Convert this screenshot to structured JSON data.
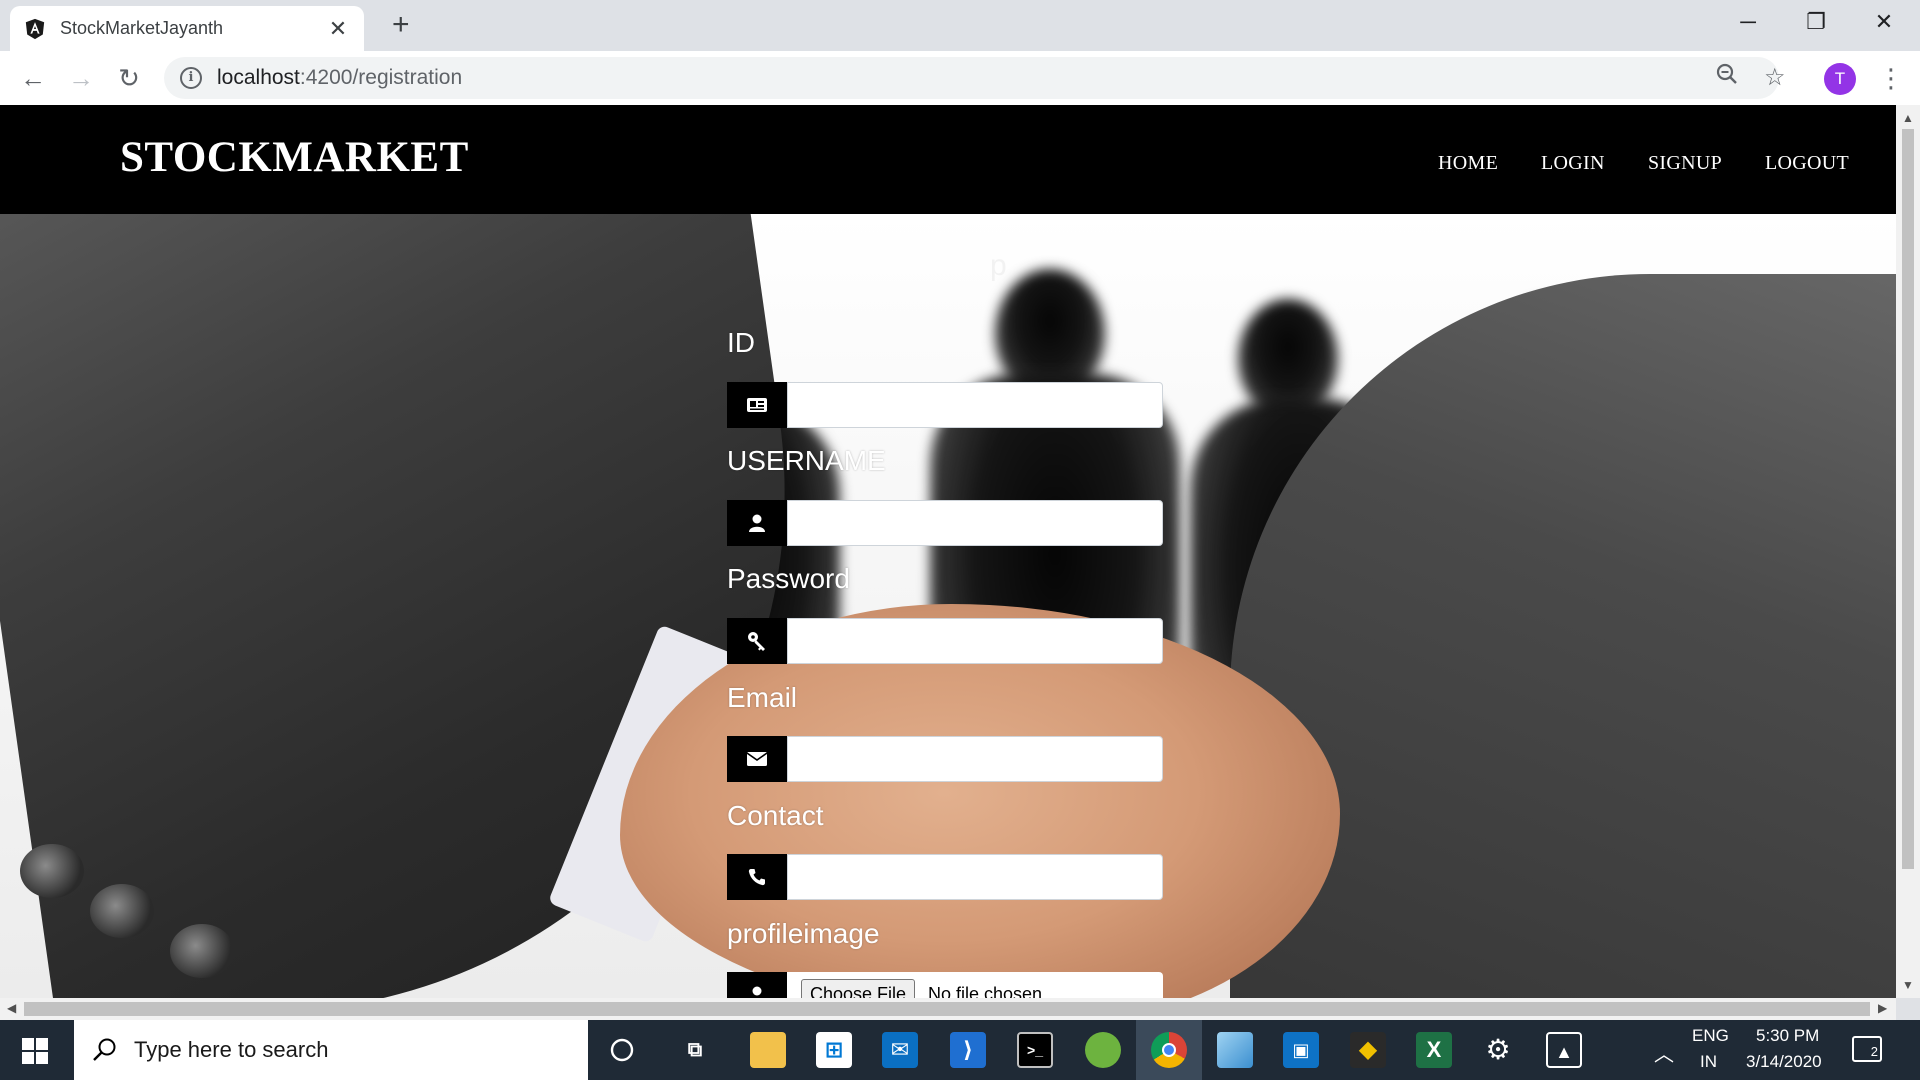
{
  "browser": {
    "tab_title": "StockMarketJayanth",
    "tab_close": "✕",
    "new_tab": "+",
    "url_host": "localhost",
    "url_path": ":4200/registration",
    "profile_initial": "T",
    "minimize": "─",
    "restore": "❐",
    "close": "✕"
  },
  "navbar": {
    "brand": "STOCKMARKET",
    "links": [
      "HOME",
      "LOGIN",
      "SIGNUP",
      "LOGOUT"
    ]
  },
  "page": {
    "heading_fragment": "p"
  },
  "form": {
    "fields": [
      {
        "label": "ID",
        "icon": "id-card-icon"
      },
      {
        "label": "USERNAME",
        "icon": "user-icon"
      },
      {
        "label": "Password",
        "icon": "key-icon"
      },
      {
        "label": "Email",
        "icon": "envelope-icon"
      },
      {
        "label": "Contact",
        "icon": "phone-icon"
      },
      {
        "label": "profileimage",
        "icon": "user-icon"
      }
    ],
    "file_button": "Choose File",
    "file_status": "No file chosen"
  },
  "taskbar": {
    "search_placeholder": "Type here to search",
    "language_line1": "ENG",
    "language_line2": "IN",
    "time": "5:30 PM",
    "date": "3/14/2020",
    "notification_count": "2"
  },
  "colors": {
    "navbar_bg": "#000000",
    "taskbar_bg": "#1f2a36",
    "profile_avatar": "#9334e6"
  }
}
